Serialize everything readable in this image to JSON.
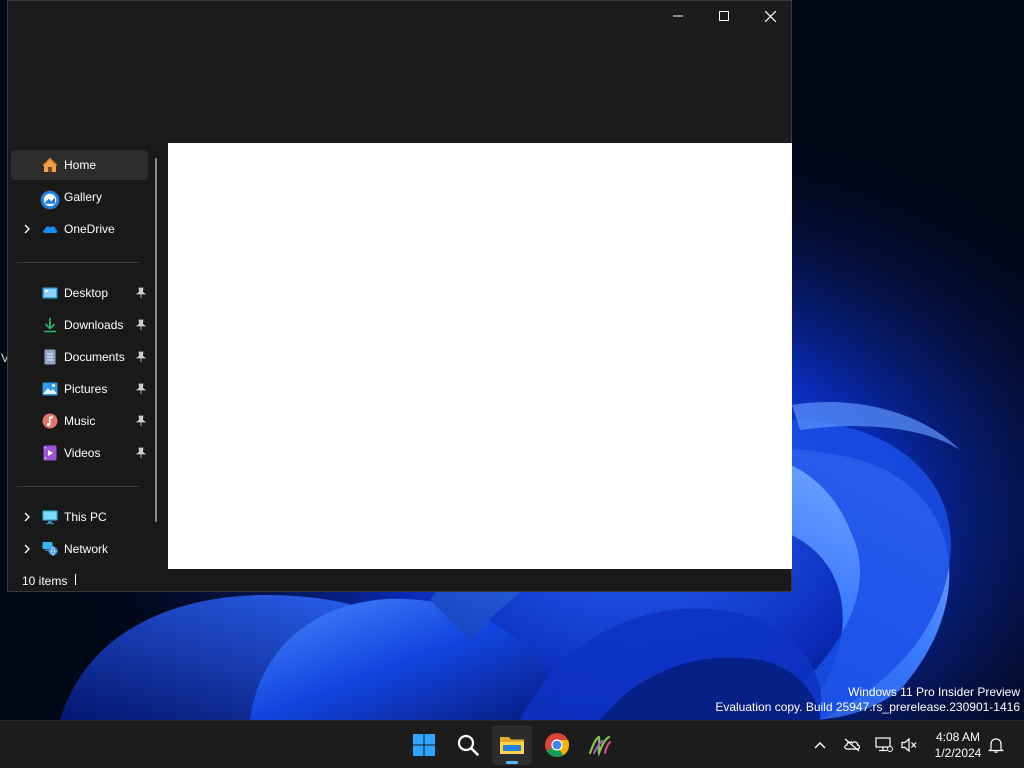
{
  "desktop": {
    "edge_glyph": "V",
    "watermark": {
      "line1": "Windows 11 Pro Insider Preview",
      "line2": "Evaluation copy. Build 25947.rs_prerelease.230901-1416"
    }
  },
  "window": {
    "controls": {
      "minimize_icon": "minimize-icon",
      "maximize_icon": "maximize-icon",
      "close_icon": "close-icon"
    },
    "nav": {
      "top_items": [
        {
          "label": "Home",
          "icon": "home-icon",
          "selected": true
        },
        {
          "label": "Gallery",
          "icon": "gallery-icon"
        },
        {
          "label": "OneDrive",
          "icon": "onedrive-icon",
          "expandable": true
        }
      ],
      "quick_access": [
        {
          "label": "Desktop",
          "icon": "desktop-folder-icon",
          "pinned": true
        },
        {
          "label": "Downloads",
          "icon": "downloads-icon",
          "pinned": true
        },
        {
          "label": "Documents",
          "icon": "documents-icon",
          "pinned": true
        },
        {
          "label": "Pictures",
          "icon": "pictures-icon",
          "pinned": true
        },
        {
          "label": "Music",
          "icon": "music-icon",
          "pinned": true
        },
        {
          "label": "Videos",
          "icon": "videos-icon",
          "pinned": true
        }
      ],
      "bottom_items": [
        {
          "label": "This PC",
          "icon": "this-pc-icon",
          "expandable": true
        },
        {
          "label": "Network",
          "icon": "network-icon",
          "expandable": true
        }
      ]
    },
    "status": {
      "item_count": "10 items"
    }
  },
  "taskbar": {
    "apps": [
      {
        "name": "start",
        "icon": "windows-start-icon"
      },
      {
        "name": "search",
        "icon": "search-icon"
      },
      {
        "name": "file-explorer",
        "icon": "file-explorer-icon",
        "active": true
      },
      {
        "name": "chrome",
        "icon": "chrome-icon"
      },
      {
        "name": "app",
        "icon": "app-icon"
      }
    ],
    "tray": {
      "icons": [
        "chevron-up-icon",
        "onedrive-offline-icon",
        "network-icon",
        "volume-muted-icon",
        "notification-bell-icon"
      ],
      "time": "4:08 AM",
      "date": "1/2/2024"
    }
  },
  "colors": {
    "accent": "#4cc2ff",
    "window_bg": "#1c1c1c",
    "nav_selected": "#2d2d2d",
    "taskbar_bg": "#1c1c1c"
  }
}
